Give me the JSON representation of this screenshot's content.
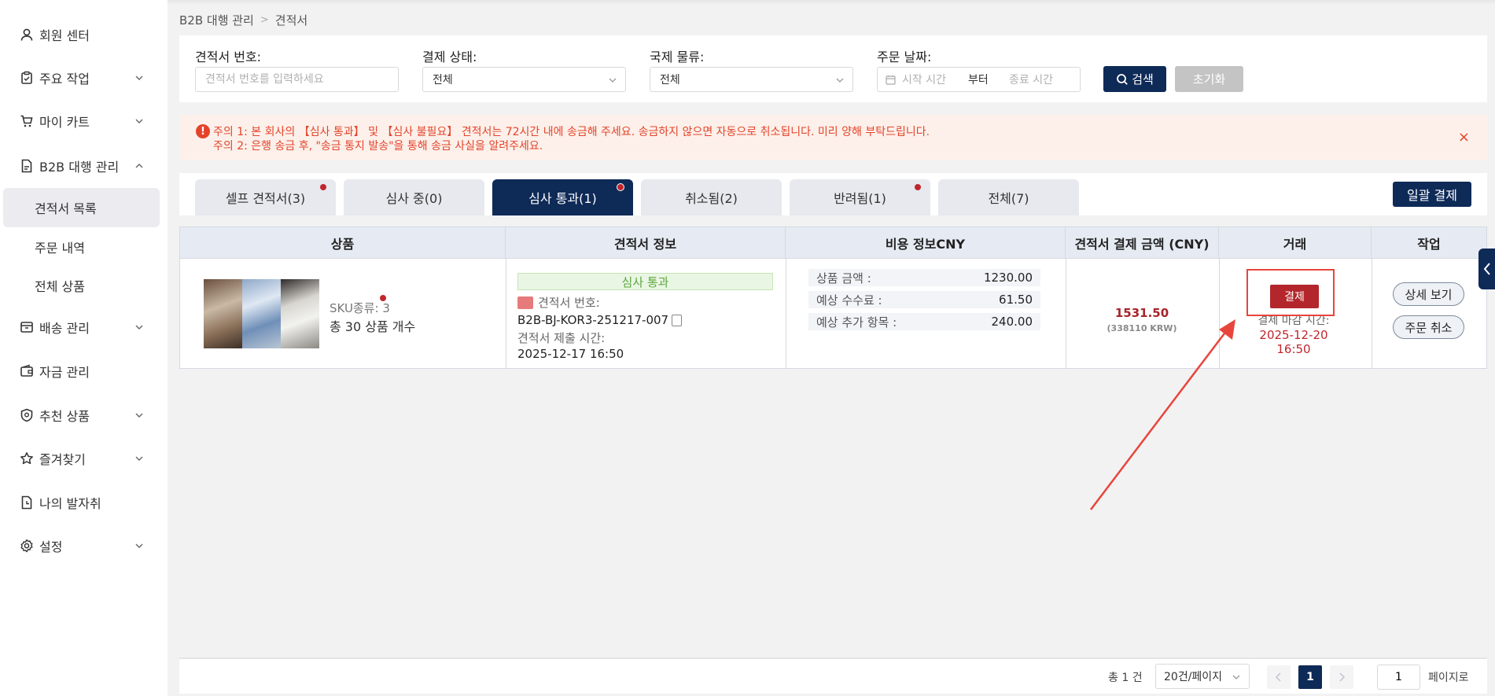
{
  "sidebar": {
    "items": [
      {
        "label": "회원 센터",
        "icon": "user-icon"
      },
      {
        "label": "주요 작업",
        "icon": "clipboard-icon",
        "expandable": true
      },
      {
        "label": "마이 카트",
        "icon": "cart-icon",
        "expandable": true
      },
      {
        "label": "B2B 대행 관리",
        "icon": "document-icon",
        "expanded": true
      },
      {
        "label": "배송 관리",
        "icon": "box-icon",
        "expandable": true
      },
      {
        "label": "자금 관리",
        "icon": "wallet-icon"
      },
      {
        "label": "추천 상품",
        "icon": "badge-icon",
        "expandable": true
      },
      {
        "label": "즐겨찾기",
        "icon": "star-icon",
        "expandable": true
      },
      {
        "label": "나의 발자취",
        "icon": "history-icon"
      },
      {
        "label": "설정",
        "icon": "gear-icon",
        "expandable": true
      }
    ],
    "sub_items": [
      {
        "label": "견적서 목록",
        "active": true
      },
      {
        "label": "주문 내역"
      },
      {
        "label": "전체 상품"
      }
    ]
  },
  "breadcrumb": {
    "parent": "B2B 대행 관리",
    "separator": ">",
    "current": "견적서"
  },
  "filters": {
    "quote_no_label": "견적서 번호:",
    "quote_no_placeholder": "견적서 번호를 입력하세요",
    "payment_label": "결제 상태:",
    "payment_value": "전체",
    "logistics_label": "국제 물류:",
    "logistics_value": "전체",
    "date_label": "주문 날짜:",
    "date_start_placeholder": "시작 시간",
    "date_sep": "부터",
    "date_end_placeholder": "종료 시간",
    "search_label": "검색",
    "reset_label": "초기화"
  },
  "notice": {
    "line1": "주의 1: 본 회사의 【심사 통과】 및 【심사 불필요】 견적서는 72시간 내에 송금해 주세요. 송금하지 않으면 자동으로 취소됩니다. 미리 양해 부탁드립니다.",
    "line2": "주의 2: 은행 송금 후, \"송금 통지 발송\"을 통해 송금 사실을 알려주세요.",
    "close": "×"
  },
  "tabs": [
    {
      "label": "셀프 견적서(3)",
      "dot": true
    },
    {
      "label": "심사 중(0)",
      "dot": false
    },
    {
      "label": "심사 통과(1)",
      "dot": true,
      "active": true
    },
    {
      "label": "취소됨(2)",
      "dot": false
    },
    {
      "label": "반려됨(1)",
      "dot": true
    },
    {
      "label": "전체(7)",
      "dot": false
    }
  ],
  "batch_pay_label": "일괄 결제",
  "table": {
    "headers": [
      "상품",
      "견적서 정보",
      "비용 정보CNY",
      "견적서 결제 금액 (CNY)",
      "거래",
      "작업"
    ],
    "row": {
      "sku_label": "SKU종류: 3",
      "qty_label": "총 30 상품 개수",
      "status": "심사 통과",
      "quote_no_label": "견적서 번호:",
      "quote_no": "B2B-BJ-KOR3-251217-007",
      "submit_label": "견적서 제출 시간:",
      "submit_time": "2025-12-17 16:50",
      "costs": [
        {
          "label": "상품 금액 :",
          "value": "1230.00"
        },
        {
          "label": "예상 수수료 :",
          "value": "61.50"
        },
        {
          "label": "예상 추가 항목 :",
          "value": "240.00"
        }
      ],
      "amount": "1531.50",
      "amount_krw": "(338110 KRW)",
      "pay_label": "결제",
      "deadline_label": "결제 마감 시간:",
      "deadline": "2025-12-20 16:50",
      "detail_label": "상세 보기",
      "cancel_label": "주문 취소"
    }
  },
  "pager": {
    "total": "총 1 건",
    "page_size": "20건/페이지",
    "current": "1",
    "jump_value": "1",
    "jump_label": "페이지로"
  },
  "colors": {
    "primary": "#0e2a57",
    "danger": "#b3262c",
    "notice_bg": "#fdf0ea",
    "notice_text": "#e4432a",
    "annotation": "#e8453c"
  }
}
